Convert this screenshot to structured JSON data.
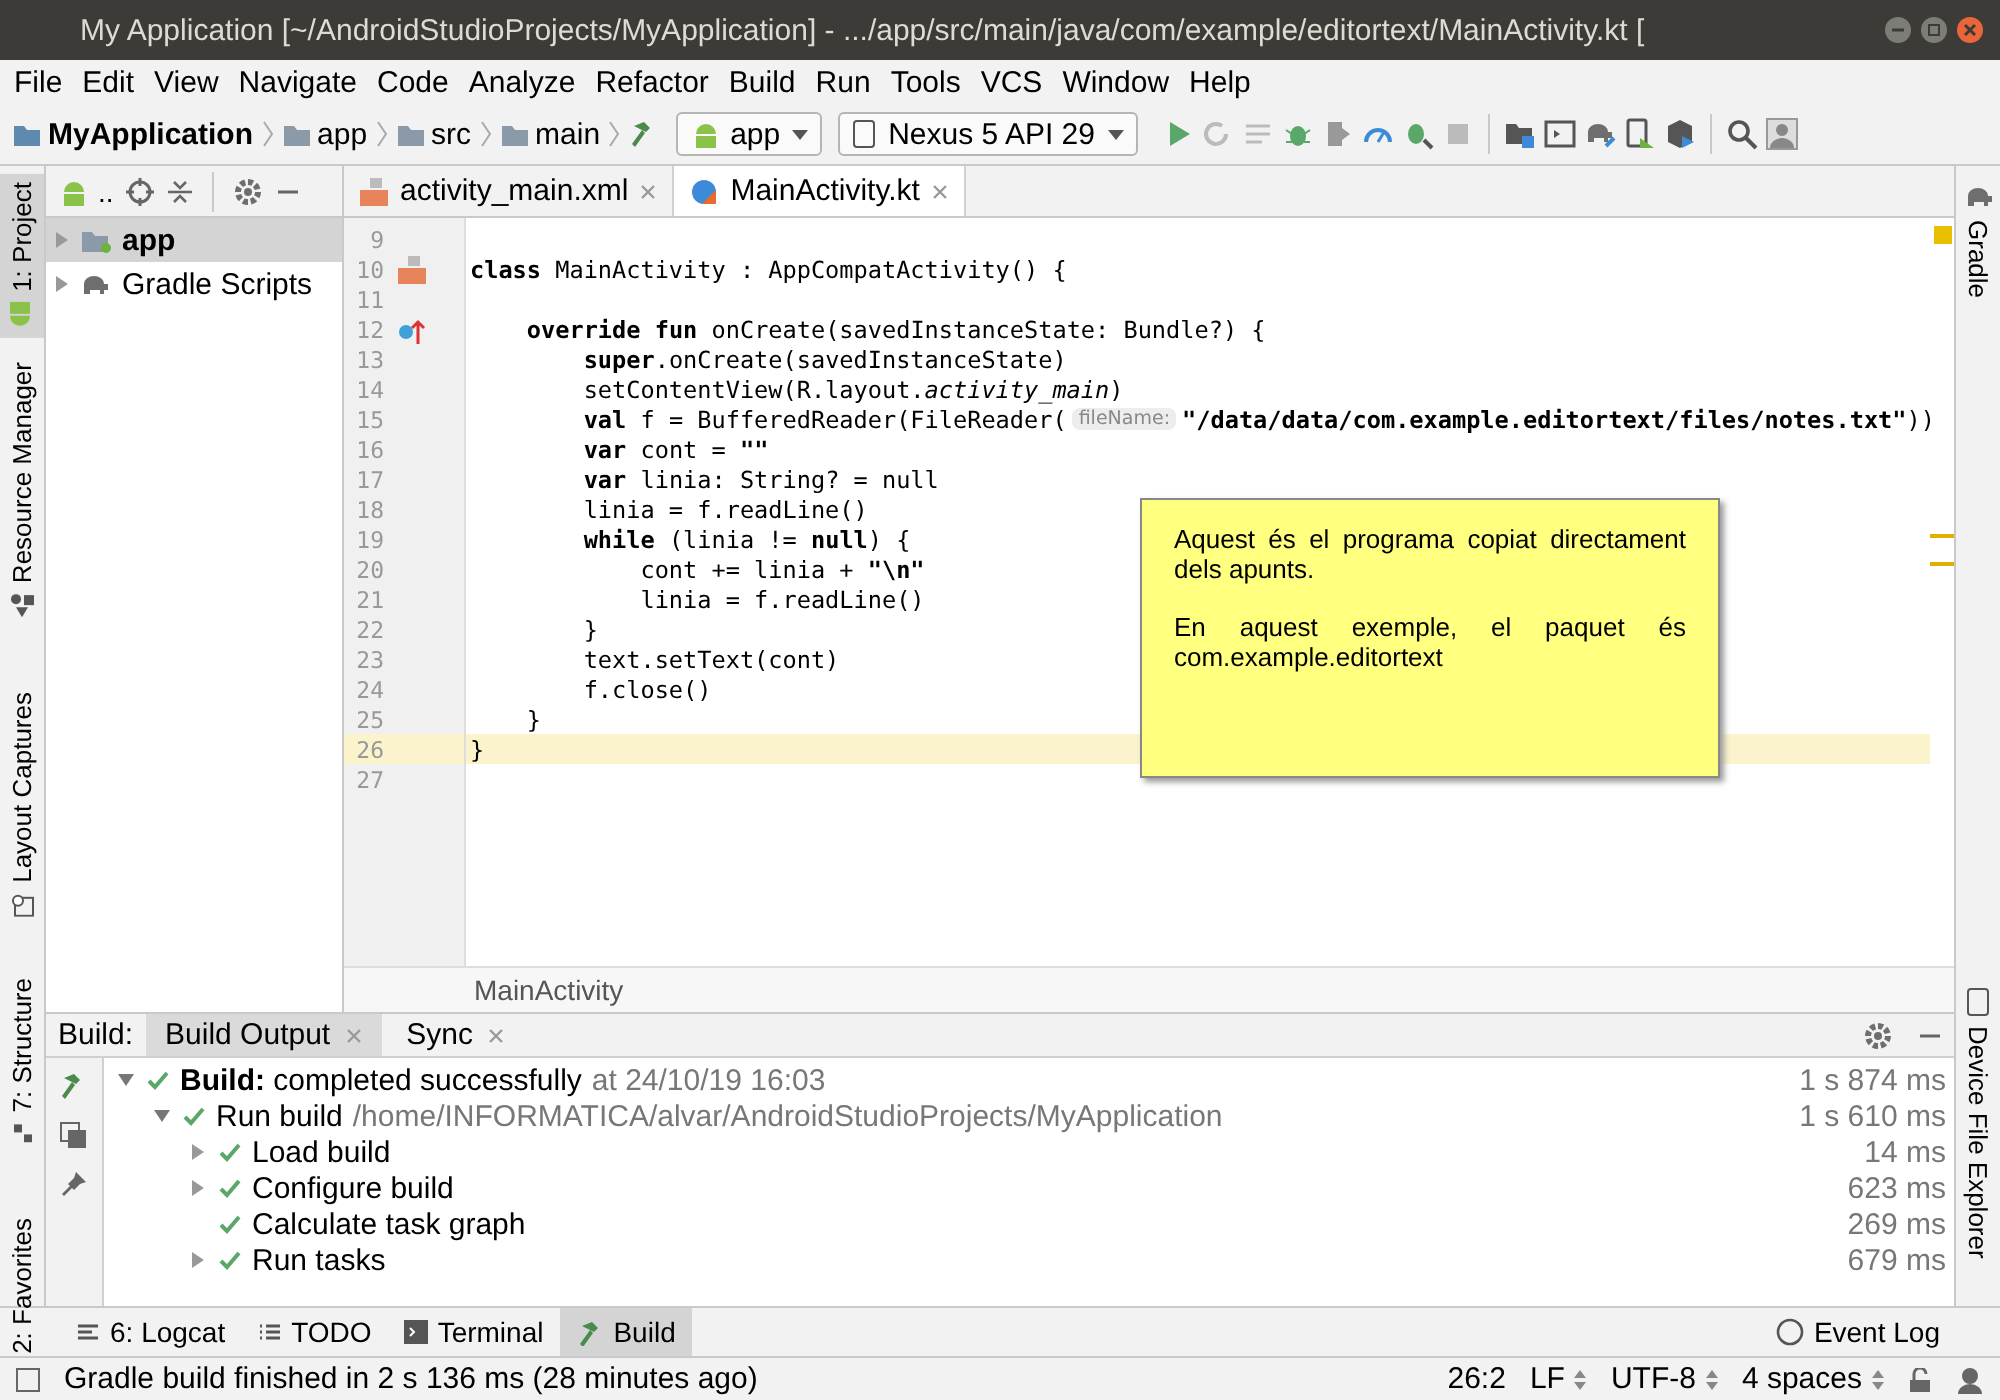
{
  "window": {
    "title": "My Application [~/AndroidStudioProjects/MyApplication] - .../app/src/main/java/com/example/editortext/MainActivity.kt ["
  },
  "menu": [
    "File",
    "Edit",
    "View",
    "Navigate",
    "Code",
    "Analyze",
    "Refactor",
    "Build",
    "Run",
    "Tools",
    "VCS",
    "Window",
    "Help"
  ],
  "breadcrumb": [
    "MyApplication",
    "app",
    "src",
    "main"
  ],
  "run_config": "app",
  "device": "Nexus 5 API 29",
  "left_stripe": [
    {
      "label": "1: Project",
      "selected": true
    },
    {
      "label": "Resource Manager",
      "selected": false
    },
    {
      "label": "Layout Captures",
      "selected": false
    },
    {
      "label": "7: Structure",
      "selected": false
    },
    {
      "label": "2: Favorites",
      "selected": false
    }
  ],
  "right_stripe": [
    {
      "label": "Gradle"
    },
    {
      "label": "Device File Explorer"
    }
  ],
  "project": {
    "dropdown": "..",
    "items": [
      {
        "label": "app",
        "kind": "module",
        "selected": true
      },
      {
        "label": "Gradle Scripts",
        "kind": "gradle",
        "selected": false
      }
    ]
  },
  "editor": {
    "tabs": [
      {
        "label": "activity_main.xml",
        "kind": "xml",
        "selected": false
      },
      {
        "label": "MainActivity.kt",
        "kind": "kotlin",
        "selected": true
      }
    ],
    "lines": [
      {
        "n": "9",
        "current": false
      },
      {
        "n": "10",
        "current": false,
        "kind": "layout",
        "text": "**class** MainActivity : AppCompatActivity() {"
      },
      {
        "n": "11",
        "current": false
      },
      {
        "n": "12",
        "current": false,
        "kind": "override",
        "text": "    **override fun** onCreate(savedInstanceState: Bundle?) {"
      },
      {
        "n": "13",
        "current": false,
        "text": "        **super**.onCreate(savedInstanceState)"
      },
      {
        "n": "14",
        "current": false,
        "text": "        setContentView(R.layout.*activity_main*)"
      },
      {
        "n": "15",
        "current": false,
        "text": "        **val** f = BufferedReader(FileReader(",
        "hint": "fileName:",
        "rest": "**\"/data/data/com.example.editortext/files/notes.txt\"**))"
      },
      {
        "n": "16",
        "current": false,
        "text": "        **var** cont = **\"\"**"
      },
      {
        "n": "17",
        "current": false,
        "text": "        **var** linia: String? = null"
      },
      {
        "n": "18",
        "current": false,
        "text": "        linia = f.readLine()"
      },
      {
        "n": "19",
        "current": false,
        "text": "        **while** (linia != **null**) {"
      },
      {
        "n": "20",
        "current": false,
        "text": "            cont += linia + **\"\\n\"**"
      },
      {
        "n": "21",
        "current": false,
        "text": "            linia = f.readLine()"
      },
      {
        "n": "22",
        "current": false,
        "text": "        }"
      },
      {
        "n": "23",
        "current": false,
        "text": "        text.setText(cont)"
      },
      {
        "n": "24",
        "current": false,
        "text": "        f.close()"
      },
      {
        "n": "25",
        "current": false,
        "text": "    }"
      },
      {
        "n": "26",
        "current": true,
        "text": "}"
      },
      {
        "n": "27",
        "current": false
      }
    ],
    "breadcrumb": "MainActivity",
    "note": [
      "Aquest és el programa copiat directament dels apunts.",
      "En aquest exemple, el paquet és com.example.editortext"
    ]
  },
  "build": {
    "label": "Build:",
    "tabs": [
      {
        "label": "Build Output",
        "selected": true
      },
      {
        "label": "Sync",
        "selected": false
      }
    ],
    "tree": [
      {
        "text": "**Build:** completed successfully",
        "detail": "at 24/10/19 16:03",
        "time": "1 s 874 ms",
        "expanded": true,
        "children": [
          {
            "text": "Run build",
            "detail": "/home/INFORMATICA/alvar/AndroidStudioProjects/MyApplication",
            "time": "1 s 610 ms",
            "expanded": true,
            "children": [
              {
                "text": "Load build",
                "time": "14 ms",
                "expanded": false
              },
              {
                "text": "Configure build",
                "time": "623 ms",
                "expanded": false
              },
              {
                "text": "Calculate task graph",
                "time": "269 ms"
              },
              {
                "text": "Run tasks",
                "time": "679 ms",
                "expanded": false
              }
            ]
          }
        ]
      }
    ]
  },
  "bottom_tabs": [
    {
      "label": "6: Logcat",
      "kind": "logcat",
      "selected": false
    },
    {
      "label": "TODO",
      "kind": "todo",
      "selected": false
    },
    {
      "label": "Terminal",
      "kind": "terminal",
      "selected": false
    },
    {
      "label": "Build",
      "kind": "build",
      "selected": true
    }
  ],
  "event_log": "Event Log",
  "status": {
    "message": "Gradle build finished in 2 s 136 ms (28 minutes ago)",
    "position": "26:2",
    "line_sep": "LF",
    "encoding": "UTF-8",
    "indent": "4 spaces"
  }
}
